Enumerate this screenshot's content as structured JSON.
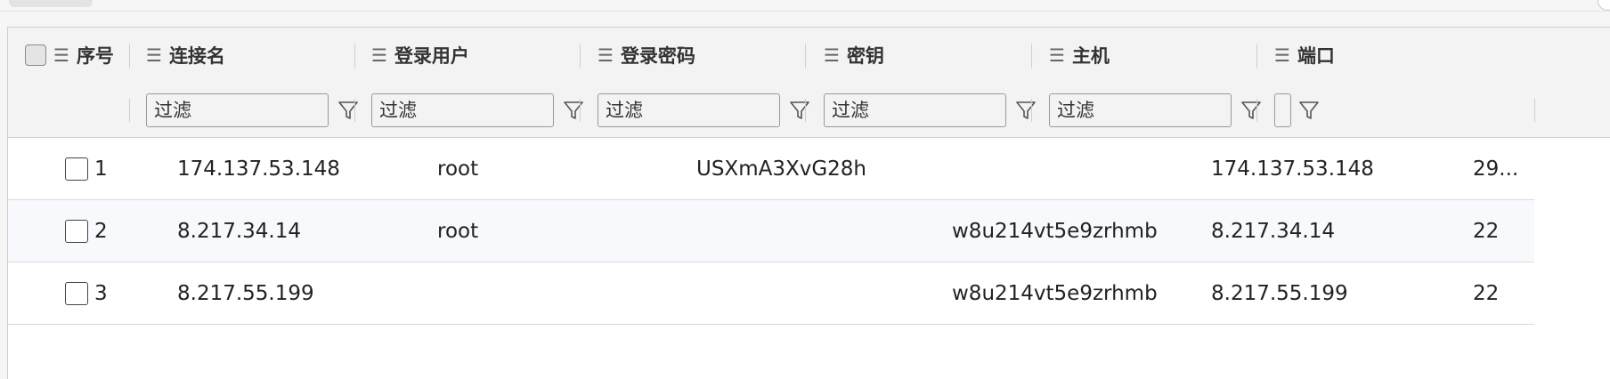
{
  "columns": {
    "index": "序号",
    "name": "连接名",
    "user": "登录用户",
    "password": "登录密码",
    "key": "密钥",
    "host": "主机",
    "port": "端口"
  },
  "filter_placeholder": "过滤",
  "icons": {
    "column_menu": "list-icon",
    "filter": "filter-funnel-icon",
    "checkbox": "checkbox-icon"
  },
  "rows": [
    {
      "index": "1",
      "name": "174.137.53.148",
      "user": "root",
      "password": "USXmA3XvG28h",
      "key": "",
      "host": "174.137.53.148",
      "port": "29..."
    },
    {
      "index": "2",
      "name": "8.217.34.14",
      "user": "root",
      "password": "",
      "key": "w8u214vt5e9zrhmb",
      "host": "8.217.34.14",
      "port": "22"
    },
    {
      "index": "3",
      "name": "8.217.55.199",
      "user": "",
      "password": "",
      "key": "w8u214vt5e9zrhmb",
      "host": "8.217.55.199",
      "port": "22"
    }
  ]
}
